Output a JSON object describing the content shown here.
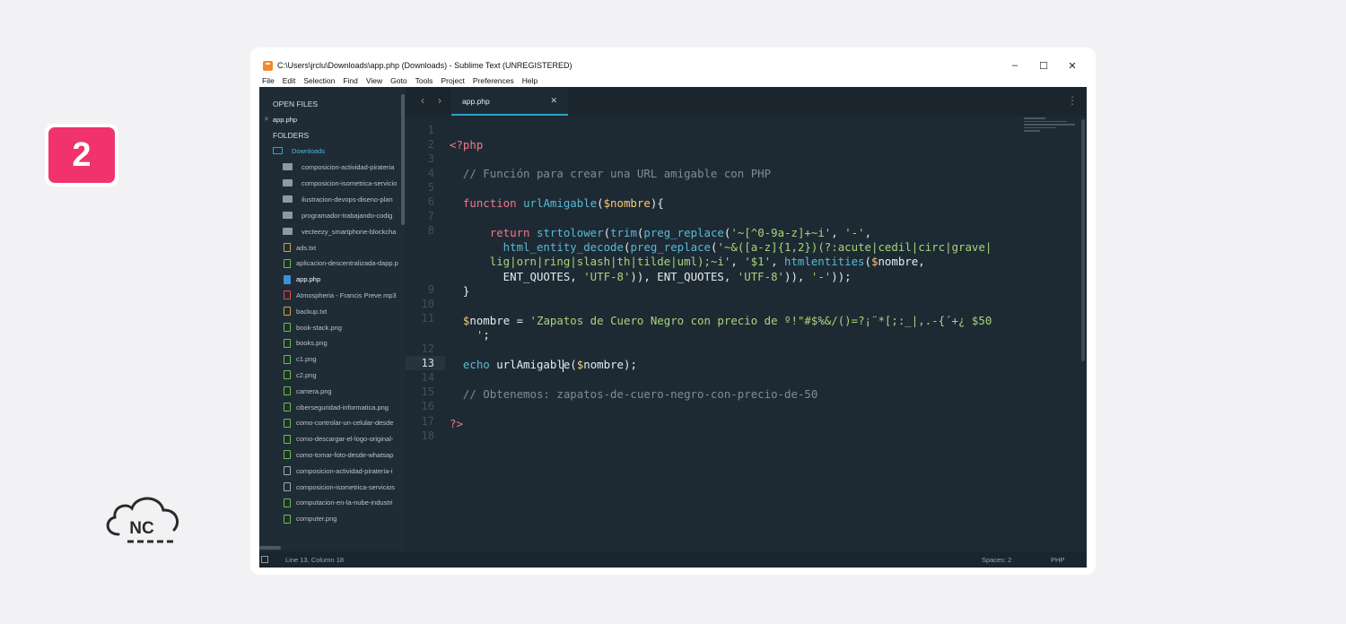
{
  "badge": {
    "number": "2"
  },
  "logo": {
    "text": "NC"
  },
  "window": {
    "title": "C:\\Users\\jrclu\\Downloads\\app.php (Downloads) - Sublime Text (UNREGISTERED)",
    "controls": {
      "minimize": "–",
      "maximize": "☐",
      "close": "✕"
    }
  },
  "menu": [
    "File",
    "Edit",
    "Selection",
    "Find",
    "View",
    "Goto",
    "Tools",
    "Project",
    "Preferences",
    "Help"
  ],
  "sidebar": {
    "open_files_header": "OPEN FILES",
    "open_file": "app.php",
    "folders_header": "FOLDERS",
    "root_folder": "Downloads",
    "subfolders": [
      "composicion-actividad-pirateria",
      "composicion-isometrica-servicio",
      "ilustracion-devops-diseno-plan",
      "programador-trabajando-codig",
      "vecteezy_smartphone-blockcha"
    ],
    "files": [
      {
        "name": "ads.txt",
        "kind": "txt"
      },
      {
        "name": "aplicacion-descentralizada-dapp.p",
        "kind": "img"
      },
      {
        "name": "app.php",
        "kind": "php"
      },
      {
        "name": "Atmospheria - Francis Preve.mp3",
        "kind": "audio"
      },
      {
        "name": "backup.txt",
        "kind": "txt"
      },
      {
        "name": "book-stack.png",
        "kind": "img"
      },
      {
        "name": "books.png",
        "kind": "img"
      },
      {
        "name": "c1.png",
        "kind": "img"
      },
      {
        "name": "c2.png",
        "kind": "img"
      },
      {
        "name": "camera.png",
        "kind": "img"
      },
      {
        "name": "ciberseguridad-informatica.png",
        "kind": "img"
      },
      {
        "name": "como-controlar-un-celular-desde",
        "kind": "img"
      },
      {
        "name": "como-descargar-el-logo-original-",
        "kind": "img"
      },
      {
        "name": "como-tomar-foto-desde-whatsap",
        "kind": "img"
      },
      {
        "name": "composicion-actividad-pirateria-i",
        "kind": "zip"
      },
      {
        "name": "composicion-isometrica-servicios",
        "kind": "zip"
      },
      {
        "name": "computacion-en-la-nube-industri",
        "kind": "img"
      },
      {
        "name": "computer.png",
        "kind": "img"
      }
    ]
  },
  "tab": {
    "label": "app.php",
    "close": "✕"
  },
  "nav": {
    "back": "‹",
    "forward": "›",
    "more": "⋮"
  },
  "editor": {
    "line_numbers": [
      "1",
      "2",
      "3",
      "4",
      "5",
      "6",
      "7",
      "8",
      "9",
      "10",
      "11",
      "12",
      "13",
      "14",
      "15",
      "16",
      "17",
      "18"
    ],
    "active_line": "13",
    "lines": [
      {
        "segments": [
          {
            "c": "c-kw",
            "t": "<?php"
          }
        ]
      },
      {
        "segments": [
          {
            "c": "c-comment",
            "t": "  // Función para crear una URL amigable con PHP"
          }
        ]
      },
      {
        "segments": [
          {
            "c": "c-kw",
            "t": "  function "
          },
          {
            "c": "c-fn",
            "t": "urlAmigable"
          },
          {
            "c": "c-op",
            "t": "("
          },
          {
            "c": "c-var",
            "t": "$nombre"
          },
          {
            "c": "c-op",
            "t": "){"
          }
        ]
      },
      {
        "segments": [
          {
            "c": "c-kw",
            "t": "      return "
          },
          {
            "c": "c-fn",
            "t": "strtolower"
          },
          {
            "c": "c-op",
            "t": "("
          },
          {
            "c": "c-fn",
            "t": "trim"
          },
          {
            "c": "c-op",
            "t": "("
          },
          {
            "c": "c-fn",
            "t": "preg_replace"
          },
          {
            "c": "c-op",
            "t": "("
          },
          {
            "c": "c-str",
            "t": "'~[^0-9a-z]+~i'"
          },
          {
            "c": "c-op",
            "t": ", "
          },
          {
            "c": "c-str",
            "t": "'-'"
          },
          {
            "c": "c-op",
            "t": ","
          }
        ]
      },
      {
        "segments": [
          {
            "c": "c-fn",
            "t": "        html_entity_decode"
          },
          {
            "c": "c-op",
            "t": "("
          },
          {
            "c": "c-fn",
            "t": "preg_replace"
          },
          {
            "c": "c-op",
            "t": "("
          },
          {
            "c": "c-str",
            "t": "'~&([a-z]{1,2})(?:acute|cedil|circ|grave|"
          }
        ]
      },
      {
        "segments": [
          {
            "c": "c-str",
            "t": "      lig|orn|ring|slash|th|tilde|uml);~i'"
          },
          {
            "c": "c-op",
            "t": ", "
          },
          {
            "c": "c-str",
            "t": "'$1'"
          },
          {
            "c": "c-op",
            "t": ", "
          },
          {
            "c": "c-fn",
            "t": "htmlentities"
          },
          {
            "c": "c-op",
            "t": "("
          },
          {
            "c": "c-var",
            "t": "$"
          },
          {
            "c": "c-plain",
            "t": "nombre"
          },
          {
            "c": "c-op",
            "t": ","
          }
        ]
      },
      {
        "segments": [
          {
            "c": "c-plain",
            "t": "        ENT_QUOTES"
          },
          {
            "c": "c-op",
            "t": ", "
          },
          {
            "c": "c-str",
            "t": "'UTF-8'"
          },
          {
            "c": "c-op",
            "t": ")), "
          },
          {
            "c": "c-plain",
            "t": "ENT_QUOTES"
          },
          {
            "c": "c-op",
            "t": ", "
          },
          {
            "c": "c-str",
            "t": "'UTF-8'"
          },
          {
            "c": "c-op",
            "t": ")), "
          },
          {
            "c": "c-str",
            "t": "'-'"
          },
          {
            "c": "c-op",
            "t": "));"
          }
        ]
      },
      {
        "segments": [
          {
            "c": "c-op",
            "t": "  }"
          }
        ]
      },
      {
        "segments": [
          {
            "c": "c-var",
            "t": "  $"
          },
          {
            "c": "c-plain",
            "t": "nombre"
          },
          {
            "c": "c-op",
            "t": " = "
          },
          {
            "c": "c-str",
            "t": "'Zapatos de Cuero Negro con precio de º!\"#$%&/()=?¡¨*[;:_|,.-{´+¿ $50"
          }
        ]
      },
      {
        "segments": [
          {
            "c": "c-str",
            "t": "    '"
          },
          {
            "c": "c-op",
            "t": ";"
          }
        ]
      },
      {
        "segments": [
          {
            "c": "c-fn",
            "t": "  echo "
          },
          {
            "c": "c-plain",
            "t": "urlAmigabl"
          },
          {
            "c": "cursor",
            "t": ""
          },
          {
            "c": "c-plain",
            "t": "e"
          },
          {
            "c": "c-op",
            "t": "("
          },
          {
            "c": "c-var",
            "t": "$"
          },
          {
            "c": "c-plain",
            "t": "nombre"
          },
          {
            "c": "c-op",
            "t": ");"
          }
        ]
      },
      {
        "segments": [
          {
            "c": "c-comment",
            "t": "  // Obtenemos: zapatos-de-cuero-negro-con-precio-de-50"
          }
        ]
      },
      {
        "segments": [
          {
            "c": "c-kw",
            "t": "?>"
          }
        ]
      }
    ]
  },
  "status": {
    "position": "Line 13, Column 18",
    "spaces": "Spaces: 2",
    "syntax": "PHP"
  },
  "colors": {
    "accent": "#f0336a",
    "tab_underline": "#2ea2c8",
    "editor_bg": "#1e2a33"
  }
}
